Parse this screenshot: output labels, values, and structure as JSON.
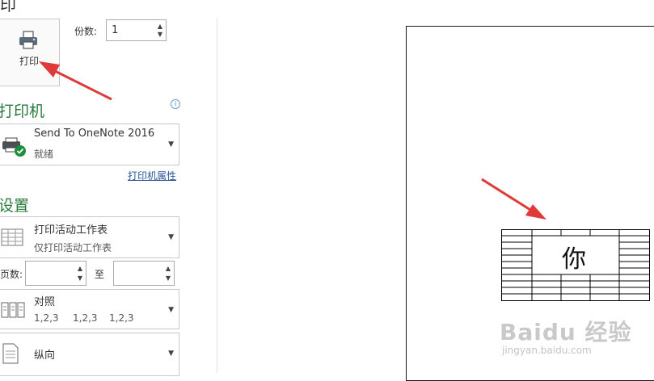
{
  "header": {
    "title_partial": "印"
  },
  "print": {
    "button_label": "打印",
    "copies_label": "份数:",
    "copies_value": "1"
  },
  "printer": {
    "section_title": "打印机",
    "name": "Send To OneNote 2016",
    "status": "就绪",
    "properties_link": "打印机属性"
  },
  "settings": {
    "section_title": "设置",
    "scope_main": "打印活动工作表",
    "scope_sub": "仅打印活动工作表",
    "pages_label": "页数:",
    "to_label": "至",
    "collate_main": "对照",
    "collate_sub": [
      "1,2,3",
      "1,2,3",
      "1,2,3"
    ],
    "orientation": "纵向"
  },
  "preview": {
    "cell_text": "你",
    "watermark": "Baidu 经验",
    "watermark_sub": "jingyan.baidu.com"
  },
  "colors": {
    "section_green": "#2a7a3e",
    "arrow_red": "#e0393a",
    "link_blue": "#2b5797"
  },
  "icons": [
    "printer-icon",
    "printer-ready-icon",
    "info-icon",
    "sheet-icon",
    "collate-icon",
    "portrait-page-icon"
  ]
}
